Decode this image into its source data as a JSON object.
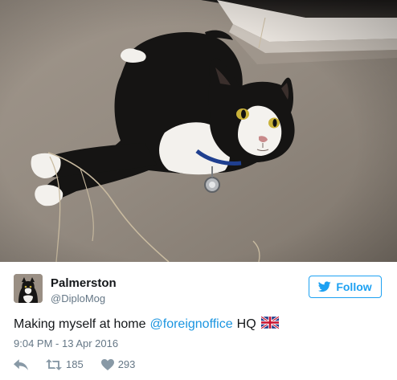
{
  "author": {
    "name": "Palmerston",
    "handle": "@DiploMog"
  },
  "follow": {
    "label": "Follow",
    "icon": "twitter-bird-icon"
  },
  "tweet": {
    "text_before": "Making myself at home",
    "mention": "@foreignoffice",
    "text_after": "HQ",
    "emoji": "uk-flag-icon",
    "timestamp": "9:04 PM - 13 Apr 2016"
  },
  "actions": {
    "reply_icon": "reply-icon",
    "retweet_icon": "retweet-icon",
    "retweets": "185",
    "like_icon": "heart-icon",
    "likes": "293"
  },
  "colors": {
    "accent": "#1da1f2",
    "link": "#1b95e0",
    "muted": "#657786",
    "text": "#14171a"
  }
}
